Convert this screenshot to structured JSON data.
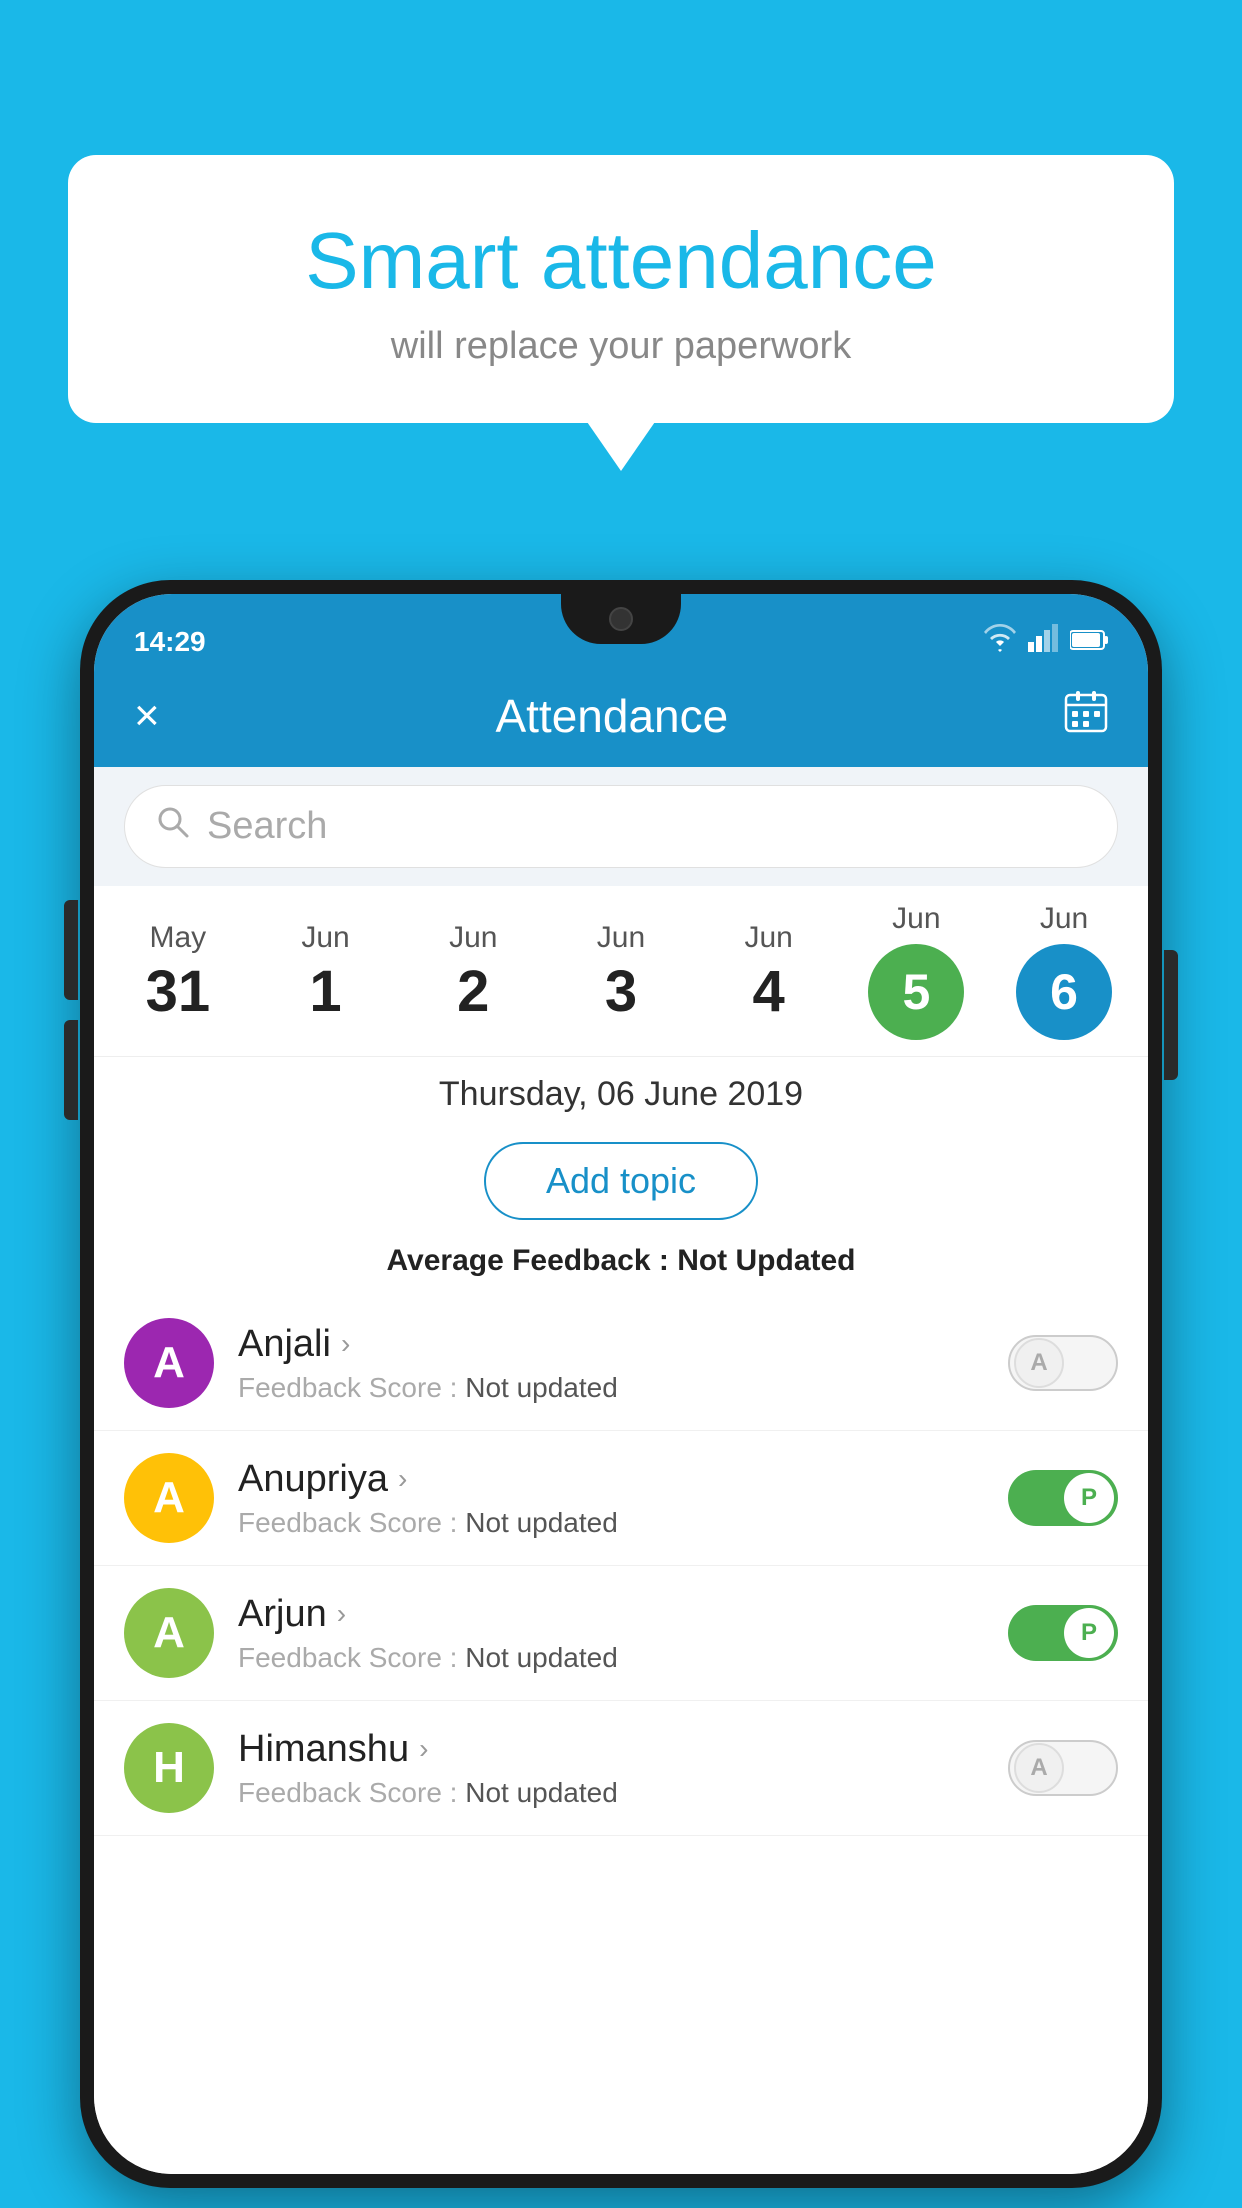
{
  "background_color": "#1ab8e8",
  "speech_bubble": {
    "title": "Smart attendance",
    "subtitle": "will replace your paperwork"
  },
  "status_bar": {
    "time": "14:29",
    "wifi": "▼",
    "signal": "▲",
    "battery": "▮"
  },
  "header": {
    "title": "Attendance",
    "close_label": "×",
    "calendar_icon": "📅"
  },
  "search": {
    "placeholder": "Search"
  },
  "dates": [
    {
      "month": "May",
      "day": "31",
      "selected": false
    },
    {
      "month": "Jun",
      "day": "1",
      "selected": false
    },
    {
      "month": "Jun",
      "day": "2",
      "selected": false
    },
    {
      "month": "Jun",
      "day": "3",
      "selected": false
    },
    {
      "month": "Jun",
      "day": "4",
      "selected": false
    },
    {
      "month": "Jun",
      "day": "5",
      "selected": "green"
    },
    {
      "month": "Jun",
      "day": "6",
      "selected": "blue"
    }
  ],
  "selected_date": "Thursday, 06 June 2019",
  "add_topic_label": "Add topic",
  "average_feedback": {
    "label": "Average Feedback :",
    "value": "Not Updated"
  },
  "students": [
    {
      "name": "Anjali",
      "avatar_letter": "A",
      "avatar_color": "#9c27b0",
      "feedback_label": "Feedback Score :",
      "feedback_value": "Not updated",
      "attendance": "absent"
    },
    {
      "name": "Anupriya",
      "avatar_letter": "A",
      "avatar_color": "#ffc107",
      "feedback_label": "Feedback Score :",
      "feedback_value": "Not updated",
      "attendance": "present"
    },
    {
      "name": "Arjun",
      "avatar_letter": "A",
      "avatar_color": "#8bc34a",
      "feedback_label": "Feedback Score :",
      "feedback_value": "Not updated",
      "attendance": "present"
    },
    {
      "name": "Himanshu",
      "avatar_letter": "H",
      "avatar_color": "#8bc34a",
      "feedback_label": "Feedback Score :",
      "feedback_value": "Not updated",
      "attendance": "absent"
    }
  ]
}
